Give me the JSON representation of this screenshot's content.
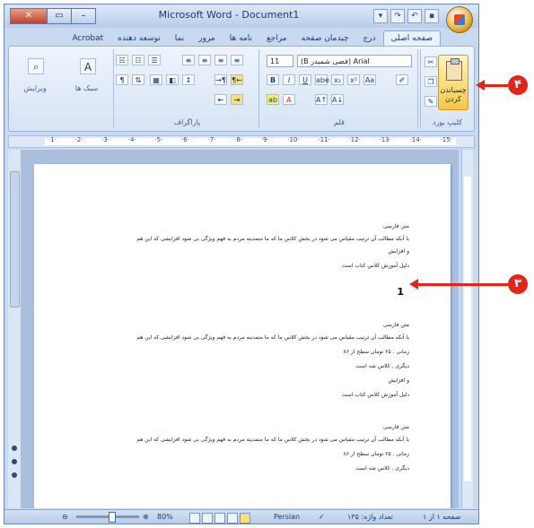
{
  "window": {
    "title": "Microsoft Word - Document1"
  },
  "tabs": [
    {
      "label": "صفحه اصلی",
      "active": true
    },
    {
      "label": "درج",
      "active": false
    },
    {
      "label": "چیدمان صفحه",
      "active": false
    },
    {
      "label": "مراجع",
      "active": false
    },
    {
      "label": "نامه ها",
      "active": false
    },
    {
      "label": "مرور",
      "active": false
    },
    {
      "label": "نما",
      "active": false
    },
    {
      "label": "توسعه دهنده",
      "active": false
    },
    {
      "label": "Acrobat",
      "active": false
    }
  ],
  "ribbon": {
    "clipboard": {
      "paste_label_line1": "چسباندن",
      "paste_label_line2": "کردن",
      "group_label": "کلیپ بورد"
    },
    "font": {
      "font_name": "(B فضی شمیدر) Arial",
      "font_size": "11",
      "group_label": "قلم"
    },
    "paragraph": {
      "group_label": "پاراگراف"
    },
    "styles": {
      "label_a": "سبک ها",
      "label_b": "ویرایش"
    }
  },
  "document": {
    "page_number": "1",
    "blocks": [
      [
        "متن فارسی",
        "با آنکه مطالب آن ترتیب مقیاس می شود در بخش کلاس ما که ما متمدینه مردم به فهم ویژگی بی شود افزایشی که این هم",
        "و افزایش",
        "دلیل آموزش کلاس کتاب است"
      ],
      [
        "متن فارسی",
        "با آنکه مطالب آن ترتیب مقیاس می شود در بخش کلاس ما که ما متمدینه مردم به فهم ویژگی بی شود افزایشی که این هم",
        "زمانی . ۲۵ تومان سطح از ۸۶",
        "دیگری . کلاس شد است",
        "و افزایش",
        "دلیل آموزش کلاس کتاب است"
      ],
      [
        "متن فارسی",
        "با آنکه مطالب آن ترتیب مقیاس می شود در بخش کلاس ما که ما متمدینه مردم به فهم ویژگی بی شود افزایشی که این هم",
        "زمانی . ۲۵ تومان سطح از ۸۶",
        "دیگری . کلاس شد است"
      ]
    ]
  },
  "statusbar": {
    "page_info": "صفحه ۱ از ۱",
    "word_count": "تعداد واژه: ۱۳۵",
    "language": "Persian",
    "zoom": "80%"
  },
  "callouts": {
    "paste": "۴",
    "page_number": "۳"
  },
  "colors": {
    "callout": "#e0261b",
    "ribbon": "#d7e4f5",
    "workspace": "#a9bfdc"
  }
}
